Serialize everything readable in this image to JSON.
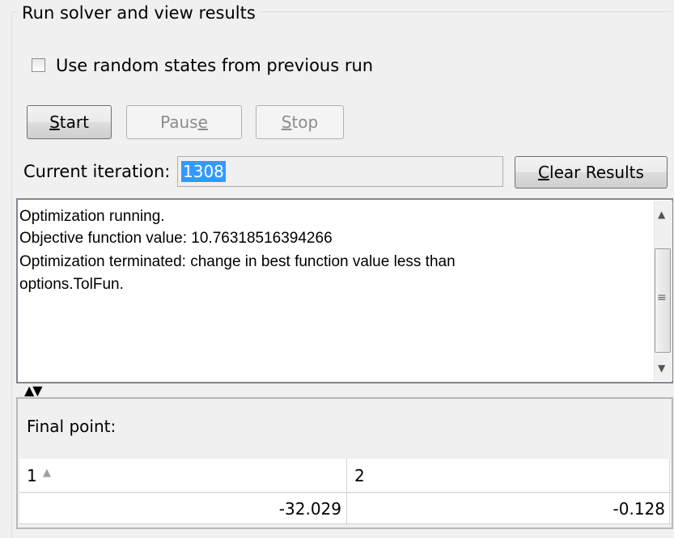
{
  "group": {
    "title": "Run solver and view results"
  },
  "options": {
    "use_random_states_label": "Use random states from previous run",
    "use_random_states_checked": false
  },
  "buttons": {
    "start": "Start",
    "pause": "Pause",
    "stop": "Stop",
    "clear_results": "Clear Results"
  },
  "iteration": {
    "label": "Current iteration:",
    "value": "1308"
  },
  "output": {
    "lines": [
      "Optimization running.",
      "Objective function value: 10.76318516394266",
      "Optimization terminated: change in best function value less than",
      "options.TolFun."
    ]
  },
  "final_point": {
    "label": "Final point:",
    "columns": [
      "1",
      "2"
    ],
    "values": [
      "-32.029",
      "-0.128"
    ]
  },
  "icons": {
    "scroll_up": "scroll-up-arrow",
    "scroll_down": "scroll-down-arrow",
    "splitter": "splitter-arrows",
    "sort": "sort-ascending"
  }
}
